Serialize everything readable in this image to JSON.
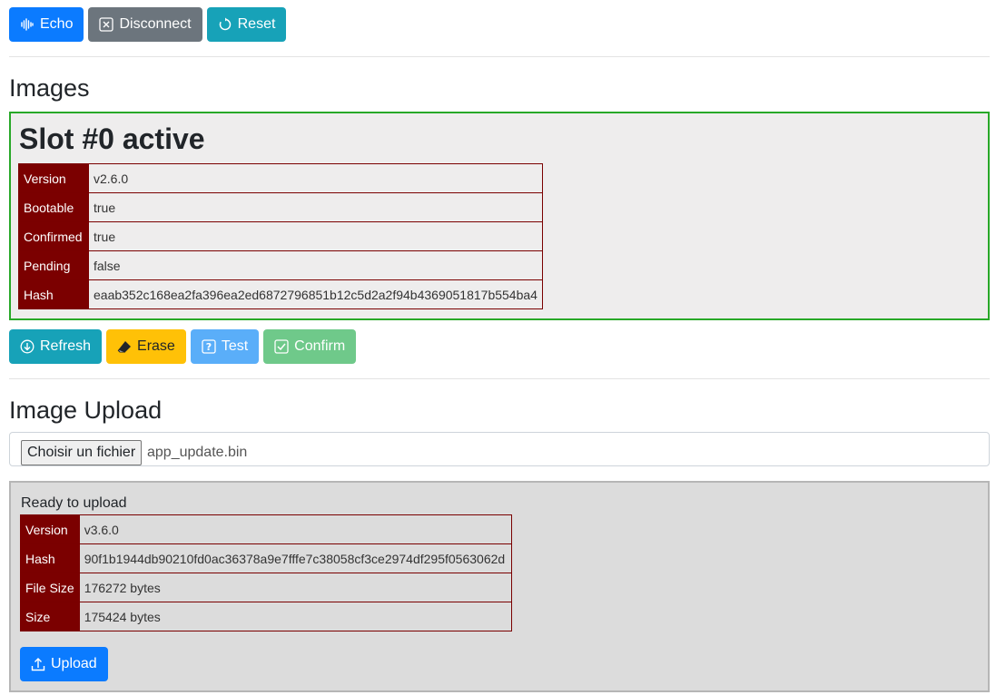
{
  "toolbar": {
    "echo_label": "Echo",
    "disconnect_label": "Disconnect",
    "reset_label": "Reset"
  },
  "images": {
    "heading": "Images",
    "slot_title": "Slot #0 active",
    "rows": [
      {
        "key": "Version",
        "value": "v2.6.0"
      },
      {
        "key": "Bootable",
        "value": "true"
      },
      {
        "key": "Confirmed",
        "value": "true"
      },
      {
        "key": "Pending",
        "value": "false"
      },
      {
        "key": "Hash",
        "value": "eaab352c168ea2fa396ea2ed6872796851b12c5d2a2f94b4369051817b554ba4"
      }
    ],
    "actions": {
      "refresh_label": "Refresh",
      "erase_label": "Erase",
      "test_label": "Test",
      "confirm_label": "Confirm"
    }
  },
  "upload": {
    "heading": "Image Upload",
    "file_button_label": "Choisir un fichier",
    "file_name": "app_update.bin",
    "status": "Ready to upload",
    "rows": [
      {
        "key": "Version",
        "value": "v3.6.0"
      },
      {
        "key": "Hash",
        "value": "90f1b1944db90210fd0ac36378a9e7fffe7c38058cf3ce2974df295f0563062d"
      },
      {
        "key": "File Size",
        "value": "176272 bytes"
      },
      {
        "key": "Size",
        "value": "175424 bytes"
      }
    ],
    "upload_label": "Upload"
  },
  "colors": {
    "primary": "#0b7bff",
    "secondary": "#6c757d",
    "info": "#17a2b8",
    "warning": "#ffc107",
    "active_border": "#28a828",
    "table_header": "#7b0000"
  }
}
